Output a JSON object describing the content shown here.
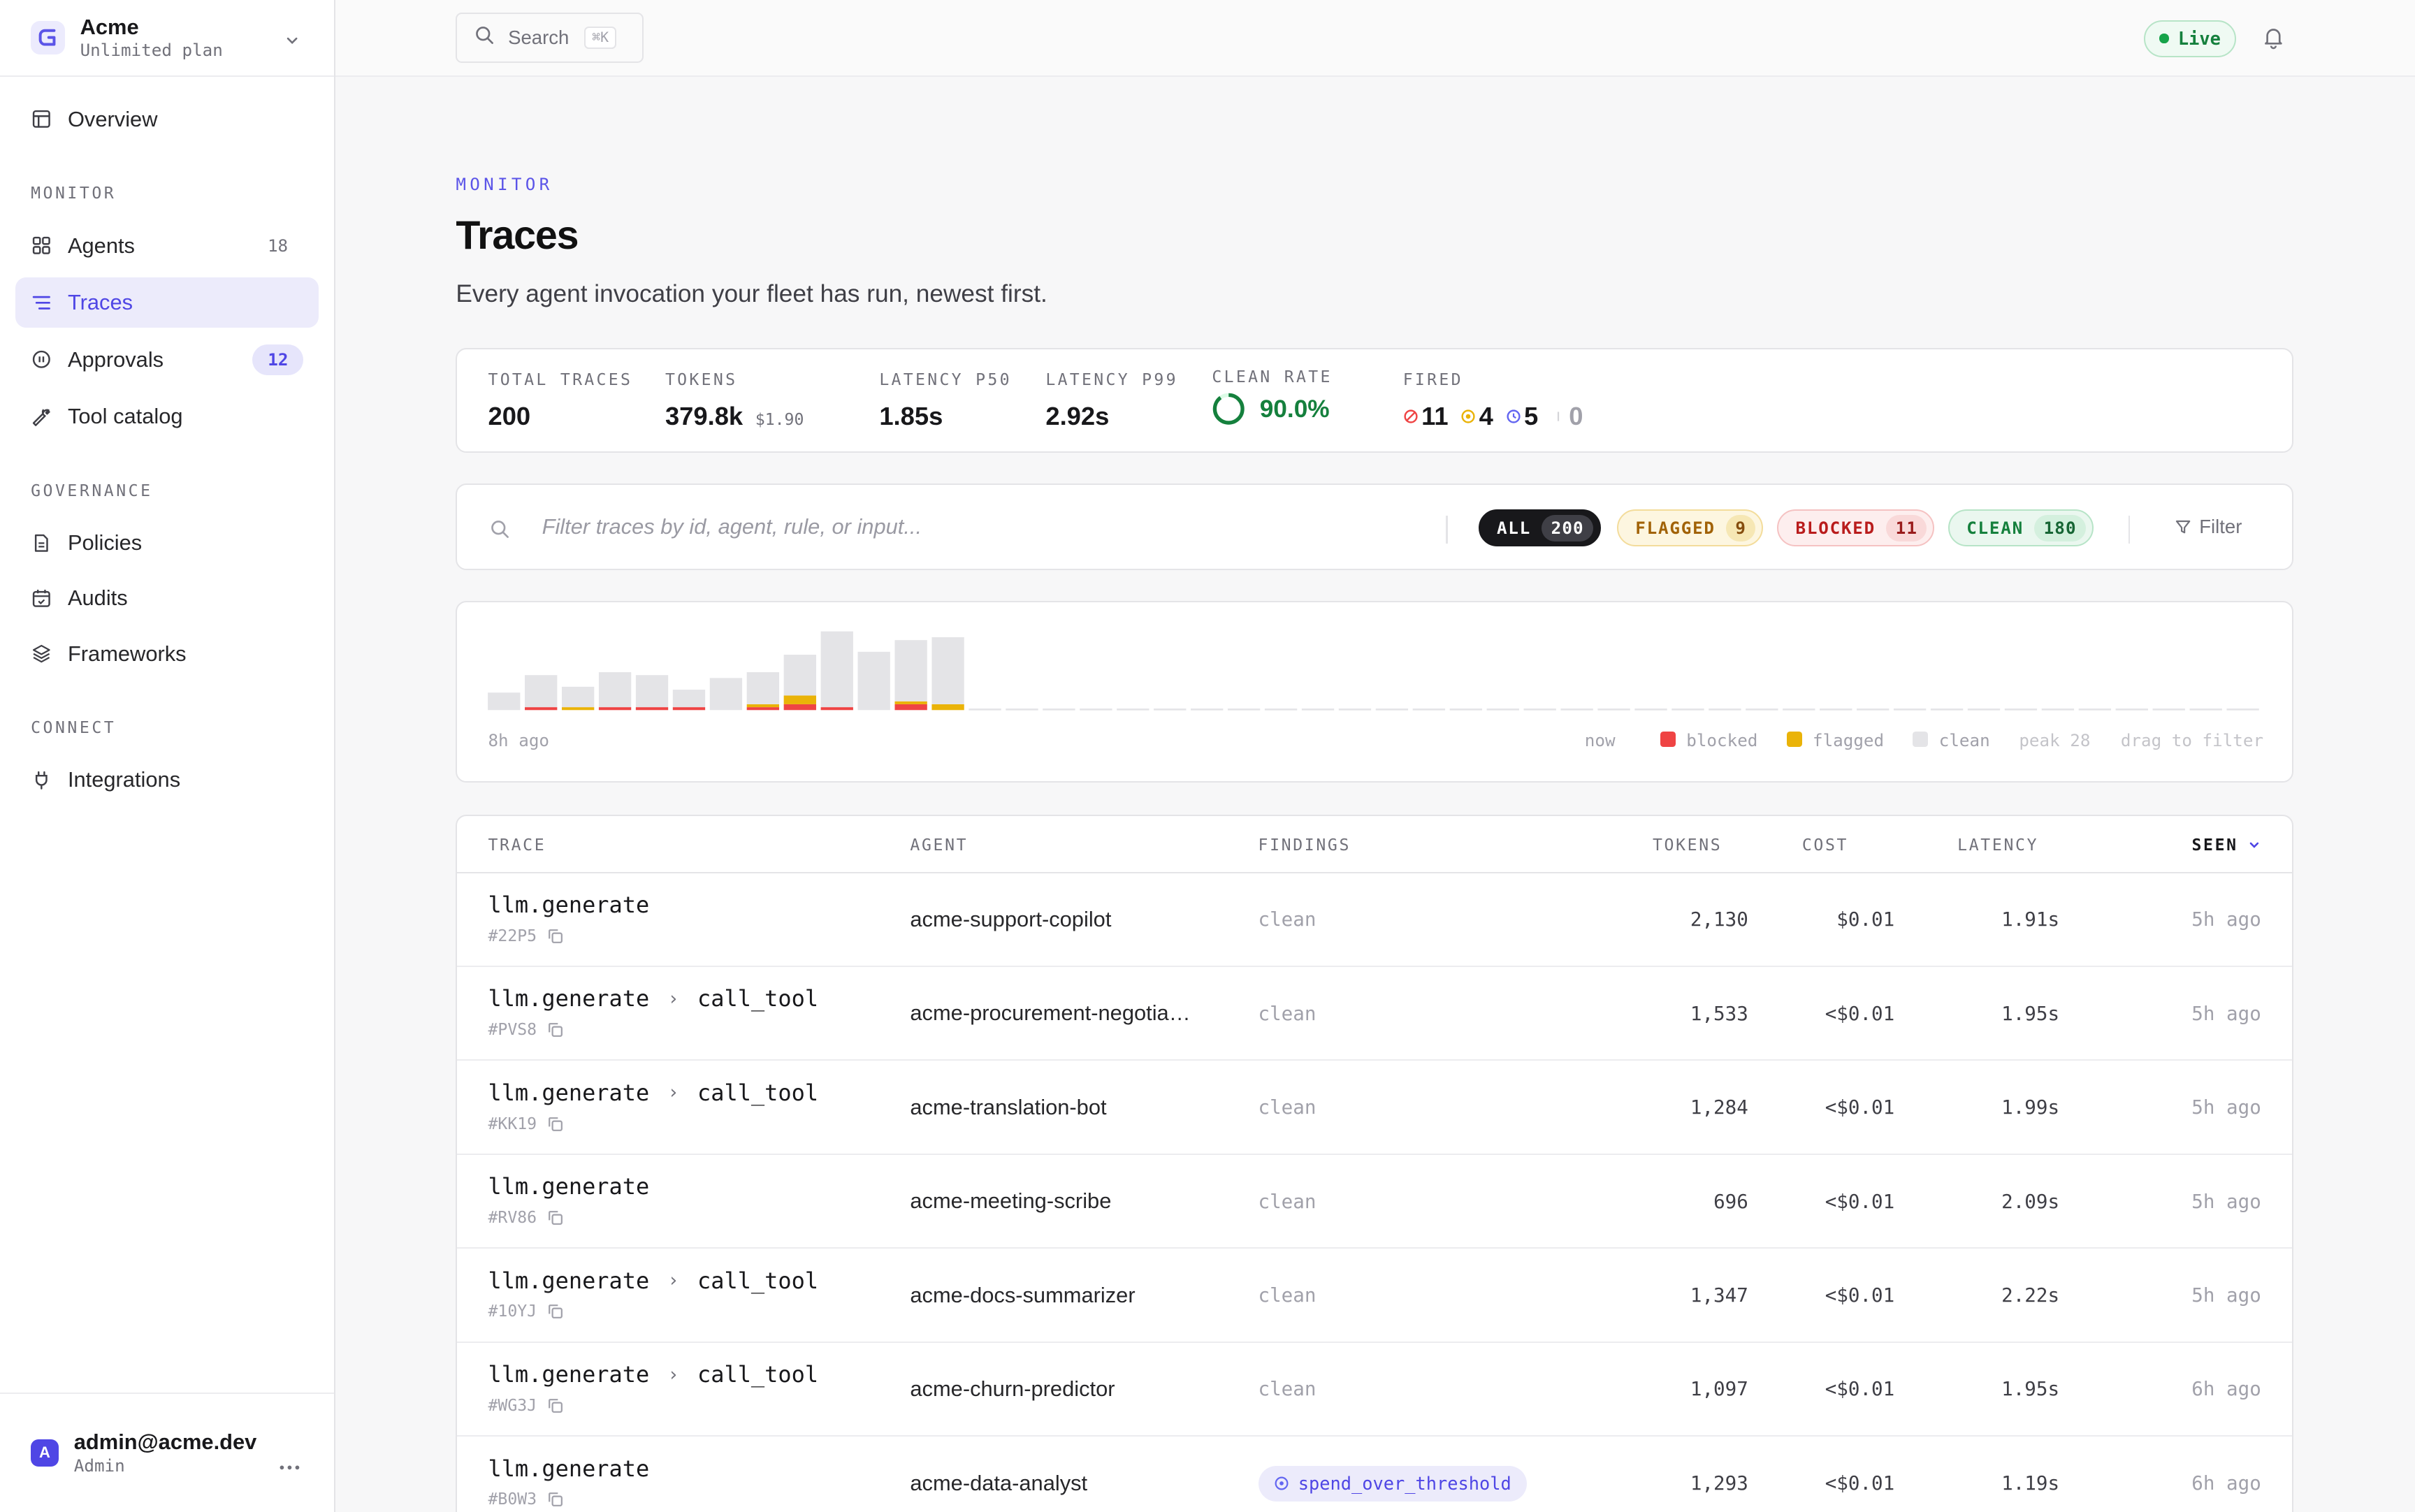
{
  "brand": {
    "name": "Acme",
    "plan": "Unlimited plan",
    "logo_icon": "logo-g-icon"
  },
  "sidebar": {
    "overview": "Overview",
    "monitor_label": "MONITOR",
    "agents": "Agents",
    "agents_count": "18",
    "traces": "Traces",
    "approvals": "Approvals",
    "approvals_badge": "12",
    "tool_catalog": "Tool catalog",
    "governance_label": "GOVERNANCE",
    "policies": "Policies",
    "audits": "Audits",
    "frameworks": "Frameworks",
    "connect_label": "CONNECT",
    "integrations": "Integrations"
  },
  "user": {
    "avatar": "A",
    "email": "admin@acme.dev",
    "role": "Admin"
  },
  "topbar": {
    "search": "Search",
    "shortcut": "⌘K",
    "live": "Live"
  },
  "page": {
    "eyebrow": "MONITOR",
    "title": "Traces",
    "subtitle": "Every agent invocation your fleet has run, newest first."
  },
  "stats": {
    "total_label": "TOTAL TRACES",
    "total": "200",
    "tokens_label": "TOKENS",
    "tokens": "379.8k",
    "tokens_cost": "$1.90",
    "p50_label": "LATENCY P50",
    "p50": "1.85s",
    "p99_label": "LATENCY P99",
    "p99": "2.92s",
    "clean_label": "CLEAN RATE",
    "clean": "90.0%",
    "clean_fraction": 0.9,
    "fired_label": "FIRED",
    "fired_blocked": "11",
    "fired_flagged": "4",
    "fired_pending": "5",
    "fired_other": "0"
  },
  "filter": {
    "placeholder": "Filter traces by id, agent, rule, or input...",
    "all_label": "ALL",
    "all_count": "200",
    "flagged_label": "FLAGGED",
    "flagged_count": "9",
    "blocked_label": "BLOCKED",
    "blocked_count": "11",
    "clean_label": "CLEAN",
    "clean_count": "180",
    "filter_button": "Filter"
  },
  "chart_data": {
    "type": "bar",
    "stacked": true,
    "x_start_label": "8h ago",
    "x_end_label": "now",
    "peak_label": "peak 28",
    "hint": "drag to filter",
    "series": [
      {
        "name": "blocked",
        "color": "#ef4444",
        "values": [
          0,
          1,
          0,
          1,
          1,
          1,
          0,
          1,
          2,
          1,
          0,
          2,
          0,
          0,
          0,
          0,
          0,
          0,
          0,
          0,
          0,
          0,
          0,
          0,
          0,
          0,
          0,
          0,
          0,
          0,
          0,
          0,
          0,
          0,
          0,
          0,
          0,
          0,
          0,
          0,
          0,
          0,
          0,
          0,
          0,
          0,
          0,
          0
        ]
      },
      {
        "name": "flagged",
        "color": "#eab308",
        "values": [
          0,
          0,
          1,
          0,
          0,
          0,
          0,
          1,
          3,
          0,
          0,
          1,
          2,
          0,
          0,
          0,
          0,
          0,
          0,
          0,
          0,
          0,
          0,
          0,
          0,
          0,
          0,
          0,
          0,
          0,
          0,
          0,
          0,
          0,
          0,
          0,
          0,
          0,
          0,
          0,
          0,
          0,
          0,
          0,
          0,
          0,
          0,
          0
        ]
      },
      {
        "name": "clean",
        "color": "#e4e4e7",
        "values": [
          6,
          11,
          7,
          12,
          11,
          6,
          11,
          11,
          14,
          26,
          20,
          21,
          23,
          0,
          0,
          0,
          0,
          0,
          0,
          0,
          0,
          0,
          0,
          0,
          0,
          0,
          0,
          0,
          0,
          0,
          0,
          0,
          0,
          0,
          0,
          0,
          0,
          0,
          0,
          0,
          0,
          0,
          0,
          0,
          0,
          0,
          0,
          0
        ]
      }
    ],
    "ylim": [
      0,
      28
    ]
  },
  "table": {
    "headers": {
      "trace": "TRACE",
      "agent": "AGENT",
      "findings": "FINDINGS",
      "tokens": "TOKENS",
      "cost": "COST",
      "latency": "LATENCY",
      "seen": "SEEN"
    },
    "rows": [
      {
        "trace": "llm.generate",
        "child": "",
        "id": "#22P5",
        "agent": "acme-support-copilot",
        "finding": "clean",
        "tokens": "2,130",
        "cost": "$0.01",
        "latency": "1.91s",
        "seen": "5h ago"
      },
      {
        "trace": "llm.generate",
        "child": "call_tool",
        "id": "#PVS8",
        "agent": "acme-procurement-negotia…",
        "finding": "clean",
        "tokens": "1,533",
        "cost": "<$0.01",
        "latency": "1.95s",
        "seen": "5h ago"
      },
      {
        "trace": "llm.generate",
        "child": "call_tool",
        "id": "#KK19",
        "agent": "acme-translation-bot",
        "finding": "clean",
        "tokens": "1,284",
        "cost": "<$0.01",
        "latency": "1.99s",
        "seen": "5h ago"
      },
      {
        "trace": "llm.generate",
        "child": "",
        "id": "#RV86",
        "agent": "acme-meeting-scribe",
        "finding": "clean",
        "tokens": "696",
        "cost": "<$0.01",
        "latency": "2.09s",
        "seen": "5h ago"
      },
      {
        "trace": "llm.generate",
        "child": "call_tool",
        "id": "#10YJ",
        "agent": "acme-docs-summarizer",
        "finding": "clean",
        "tokens": "1,347",
        "cost": "<$0.01",
        "latency": "2.22s",
        "seen": "5h ago"
      },
      {
        "trace": "llm.generate",
        "child": "call_tool",
        "id": "#WG3J",
        "agent": "acme-churn-predictor",
        "finding": "clean",
        "tokens": "1,097",
        "cost": "<$0.01",
        "latency": "1.95s",
        "seen": "6h ago"
      },
      {
        "trace": "llm.generate",
        "child": "",
        "id": "#B0W3",
        "agent": "acme-data-analyst",
        "finding": "spend_over_threshold",
        "finding_is_rule": true,
        "tokens": "1,293",
        "cost": "<$0.01",
        "latency": "1.19s",
        "seen": "6h ago"
      }
    ]
  }
}
